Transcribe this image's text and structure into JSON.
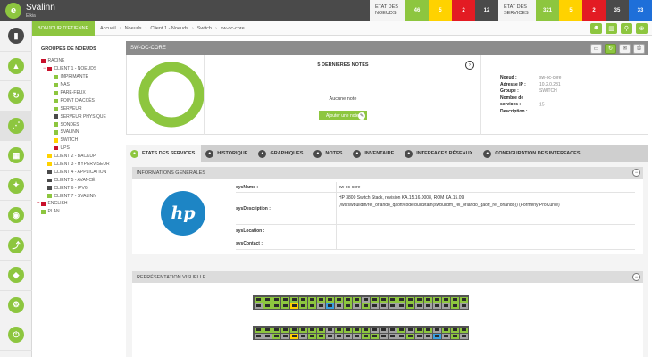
{
  "app": {
    "name": "Svalinn",
    "subtitle": "Elkia"
  },
  "status": {
    "nodes_label": "ETAT DES NOEUDS",
    "nodes_counts": [
      {
        "value": "46",
        "color": "#8dc63f"
      },
      {
        "value": "5",
        "color": "#ffd200"
      },
      {
        "value": "2",
        "color": "#e31b23"
      },
      {
        "value": "12",
        "color": "#4a4a4a"
      }
    ],
    "services_label": "ETAT DES SERVICES",
    "services_counts": [
      {
        "value": "321",
        "color": "#8dc63f"
      },
      {
        "value": "5",
        "color": "#ffd200"
      },
      {
        "value": "2",
        "color": "#e31b23"
      },
      {
        "value": "35",
        "color": "#4a4a4a"
      },
      {
        "value": "33",
        "color": "#1e6fd9"
      }
    ]
  },
  "sidebar_icons": [
    {
      "icon": "dashboard-icon",
      "glyph": "▮",
      "color": "#4a4a4a"
    },
    {
      "icon": "mountain-icon",
      "glyph": "▲",
      "color": "#8dc63f"
    },
    {
      "icon": "refresh-icon",
      "glyph": "↻",
      "color": "#8dc63f"
    },
    {
      "icon": "network-icon",
      "glyph": "⋰",
      "color": "#8dc63f"
    },
    {
      "icon": "grid-icon",
      "glyph": "▦",
      "color": "#8dc63f"
    },
    {
      "icon": "leaf-icon",
      "glyph": "✦",
      "color": "#8dc63f"
    },
    {
      "icon": "location-icon",
      "glyph": "◉",
      "color": "#8dc63f"
    },
    {
      "icon": "share-icon",
      "glyph": "⤴",
      "color": "#8dc63f"
    },
    {
      "icon": "cube-icon",
      "glyph": "◆",
      "color": "#8dc63f"
    },
    {
      "icon": "settings-icon",
      "glyph": "⚙",
      "color": "#8dc63f"
    },
    {
      "icon": "power-icon",
      "glyph": "⏻",
      "color": "#8dc63f"
    }
  ],
  "greeting": "BONJOUR D'ETIENNE",
  "breadcrumb": [
    "Accueil",
    "Noeuds",
    "Client 1 - Noeuds",
    "Switch",
    "sw-oc-core"
  ],
  "tree": {
    "title": "GROUPES DE NOEUDS",
    "items": [
      {
        "label": "RACINE",
        "color": "#c9102b",
        "level": 0,
        "toggle": ""
      },
      {
        "label": "CLIENT 1 - NOEUDS",
        "color": "#c9102b",
        "level": 1,
        "toggle": "−"
      },
      {
        "label": "IMPRIMANTE",
        "color": "#8dc63f",
        "level": 2,
        "toggle": ""
      },
      {
        "label": "NAS",
        "color": "#8dc63f",
        "level": 2,
        "toggle": ""
      },
      {
        "label": "PARE-FEUX",
        "color": "#8dc63f",
        "level": 2,
        "toggle": ""
      },
      {
        "label": "POINT D'ACCÈS",
        "color": "#8dc63f",
        "level": 2,
        "toggle": ""
      },
      {
        "label": "SERVEUR",
        "color": "#8dc63f",
        "level": 2,
        "toggle": ""
      },
      {
        "label": "SERVEUR PHYSIQUE",
        "color": "#4a4a4a",
        "level": 2,
        "toggle": ""
      },
      {
        "label": "SONDES",
        "color": "#8dc63f",
        "level": 2,
        "toggle": ""
      },
      {
        "label": "SVALINN",
        "color": "#8dc63f",
        "level": 2,
        "toggle": ""
      },
      {
        "label": "SWITCH",
        "color": "#ffd200",
        "level": 2,
        "toggle": ""
      },
      {
        "label": "UPS",
        "color": "#c9102b",
        "level": 2,
        "toggle": ""
      },
      {
        "label": "CLIENT 2 - BACKUP",
        "color": "#ffd200",
        "level": 1,
        "toggle": ""
      },
      {
        "label": "CLIENT 3 - HYPERVISEUR",
        "color": "#ffd200",
        "level": 1,
        "toggle": ""
      },
      {
        "label": "CLIENT 4 - APPLICATION",
        "color": "#4a4a4a",
        "level": 1,
        "toggle": ""
      },
      {
        "label": "CLIENT 5 - AVANCÉ",
        "color": "#4a4a4a",
        "level": 1,
        "toggle": ""
      },
      {
        "label": "CLIENT 6 - IPV6",
        "color": "#4a4a4a",
        "level": 1,
        "toggle": ""
      },
      {
        "label": "CLIENT 7 - SVALINN",
        "color": "#8dc63f",
        "level": 1,
        "toggle": ""
      },
      {
        "label": "ENGLISH",
        "color": "#c9102b",
        "level": 0,
        "toggle": "+"
      },
      {
        "label": "PLAN",
        "color": "#8dc63f",
        "level": 0,
        "toggle": ""
      }
    ]
  },
  "node": {
    "name": "SW-OC-CORE",
    "availability": "100.0%",
    "availability_fraction": 1.0,
    "notes_title": "5 DERNIÈRES NOTES",
    "notes_empty": "Aucune note",
    "add_note": "Ajouter une note",
    "info": [
      {
        "key": "Noeud :",
        "value": "sw-oc-core"
      },
      {
        "key": "Adresse IP :",
        "value": "10.2.0.231"
      },
      {
        "key": "Groupe :",
        "value": "SWITCH"
      },
      {
        "key": "Nombre de services :",
        "value": "15"
      },
      {
        "key": "Description :",
        "value": ""
      }
    ]
  },
  "tabs": [
    {
      "label": "ETATS DES SERVICES",
      "icon": "status-icon",
      "active": true
    },
    {
      "label": "HISTORIQUE",
      "icon": "history-icon",
      "active": false
    },
    {
      "label": "GRAPHIQUES",
      "icon": "chart-icon",
      "active": false
    },
    {
      "label": "NOTES",
      "icon": "notes-icon",
      "active": false
    },
    {
      "label": "INVENTAIRE",
      "icon": "inventory-icon",
      "active": false
    },
    {
      "label": "INTERFACES RÉSEAUX",
      "icon": "network-interfaces-icon",
      "active": false
    },
    {
      "label": "CONFIGURATION DES INTERFACES",
      "icon": "interface-config-icon",
      "active": false
    }
  ],
  "general": {
    "title": "INFORMATIONS GÉNÉRALES",
    "vendor_logo": "hp",
    "rows": [
      {
        "key": "sysName :",
        "value": "sw-oc-core"
      },
      {
        "key": "sysDescription :",
        "value": "HP 3800 Switch Stack, revision KA.15.16.0008, ROM KA.15.09 (/ws/swbuildm/rel_orlando_qaoff/code/build/tam(swbuildm_rel_orlando_qaoff_rel_orlando)) (Formerly ProCurve)"
      },
      {
        "key": "sysLocation :",
        "value": ""
      },
      {
        "key": "sysContact :",
        "value": ""
      }
    ]
  },
  "visual": {
    "title": "REPRÉSENTATION VISUELLE"
  },
  "port_colors": {
    "up": "#8dc63f",
    "down": "#a3a3a3",
    "warn": "#ffd200",
    "alt": "#3aa0e0"
  },
  "switches": [
    {
      "rows": [
        "UUUUUUUUUUUUDUUUUUUUUUUU",
        "DUUUWUUDBDUDUDDDDUDDDDUD"
      ]
    },
    {
      "rows": [
        "UUUUUUUUDUUUUDDDUDUUDUUU",
        "DDUDWDUUDDDDUUDDDUDDBDUD"
      ]
    }
  ]
}
